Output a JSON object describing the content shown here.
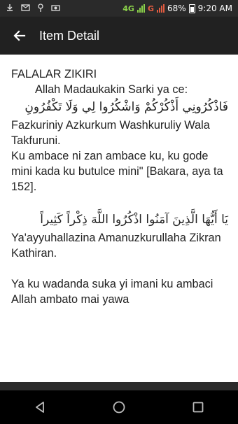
{
  "status": {
    "network_4g": "4G",
    "network_g": "G",
    "battery_percent": "68%",
    "time": "9:20 AM"
  },
  "appbar": {
    "title": "Item Detail"
  },
  "content": {
    "heading": "FALALAR ZIKIRI",
    "intro": "Allah Madaukakin Sarki ya ce:",
    "arabic1": "فَاذْكُرُونِي أَذْكُرْكُمْ وَاشْكُرُوا لِي وَلَا تَكْفُرُونِ",
    "translit1": "Fazkuriniy Azkurkum Washkuruliy Wala Takfuruni.",
    "translation1": "Ku ambace ni zan ambace ku, ku gode mini kada ku butulce mini\" [Bakara, aya ta 152].",
    "arabic2": "يَا أَيُّهَا الَّذِينَ آمَنُوا اذْكُرُوا اللَّهَ ذِكْراً كَثِيراً",
    "translit2": "Ya'ayyuhallazina Amanuzkurullaha Zikran Kathiran.",
    "translation2": "Ya ku wadanda suka yi imani ku ambaci Allah ambato mai yawa"
  },
  "icons": {
    "back": "arrow-back-icon",
    "nav_back": "nav-back-icon",
    "nav_home": "nav-home-icon",
    "nav_recent": "nav-recent-icon"
  }
}
